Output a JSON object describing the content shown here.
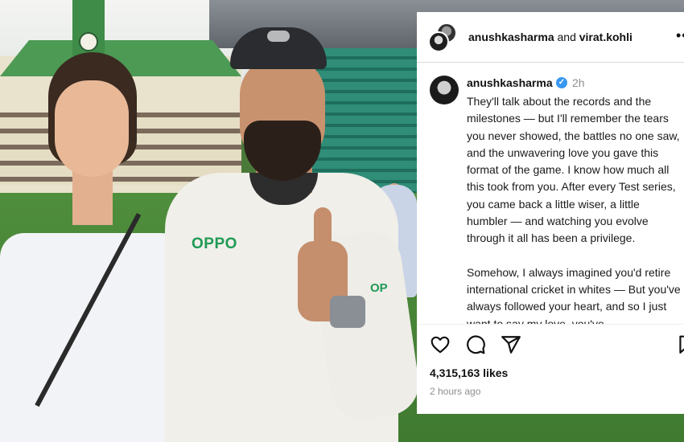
{
  "photo": {
    "sponsor_primary": "OPPO",
    "sponsor_sleeve": "OP"
  },
  "header": {
    "user_primary": "anushkasharma",
    "connector": "and",
    "user_secondary": "virat.kohli",
    "more_icon": "more-horizontal-icon"
  },
  "post": {
    "author": "anushkasharma",
    "verified_icon": "verified-badge-icon",
    "time": "2h",
    "caption_paragraphs": [
      "They'll talk about the records and the milestones — but I'll remember the tears you never showed, the battles no one saw, and the unwavering love you gave this format of the game. I know how much all this took from you. After every Test series, you came back a little wiser, a little humbler — and watching you evolve through it all has been a privilege.",
      "Somehow, I always imagined you'd retire international cricket in whites — But you've always followed your heart, and so I just want to say my love, you've"
    ]
  },
  "actions": {
    "icons": [
      "heart-icon",
      "comment-icon",
      "share-icon",
      "bookmark-icon"
    ],
    "likes": "4,315,163 likes",
    "time_ago": "2 hours ago"
  },
  "colors": {
    "verified": "#3897f0",
    "muted_text": "#8e8e8e",
    "sponsor_green": "#1f9a55"
  }
}
